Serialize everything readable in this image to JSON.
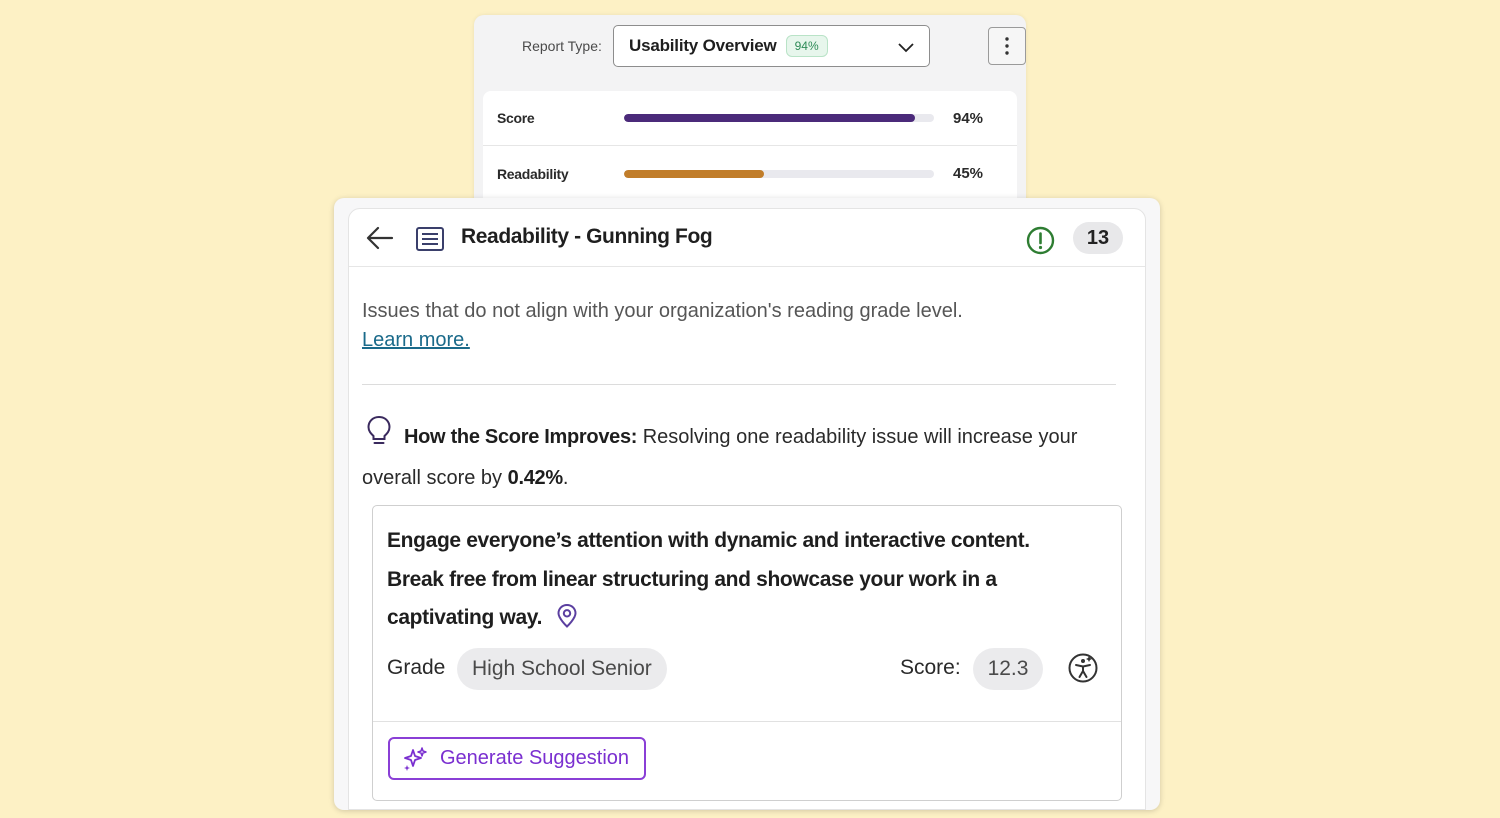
{
  "report": {
    "type_label": "Report Type:",
    "selected": "Usability Overview",
    "selected_badge": "94%",
    "metrics": [
      {
        "label": "Score",
        "value_text": "94%",
        "value": 0.94,
        "color": "#4b2a7a"
      },
      {
        "label": "Readability",
        "value_text": "45%",
        "value": 0.45,
        "color": "#c17d2a"
      }
    ]
  },
  "panel": {
    "title": "Readability - Gunning Fog",
    "count": "13",
    "description": "Issues that do not align with your organization's reading grade level.",
    "learn_more": "Learn more.",
    "improve_heading": "How the Score Improves:",
    "improve_text": " Resolving one readability issue will increase your overall score by ",
    "improve_value": "0.42%",
    "improve_tail": "."
  },
  "issue": {
    "text": "Engage everyone’s attention with dynamic and interactive content. Break free from linear structuring and showcase your work in a captivating way.",
    "grade_label": "Grade",
    "grade_value": "High School Senior",
    "score_label": "Score:",
    "score_value": "12.3",
    "generate_label": "Generate Suggestion"
  },
  "colors": {
    "background": "#fdf1c5",
    "accent_purple": "#7a2fd0",
    "warning_green": "#2e7d32",
    "link": "#1a6a8a"
  },
  "icons": [
    "chevron-down-icon",
    "kebab-menu-icon",
    "back-arrow-icon",
    "document-icon",
    "warning-icon",
    "lightbulb-icon",
    "location-pin-icon",
    "accessibility-icon",
    "sparkle-icon"
  ]
}
